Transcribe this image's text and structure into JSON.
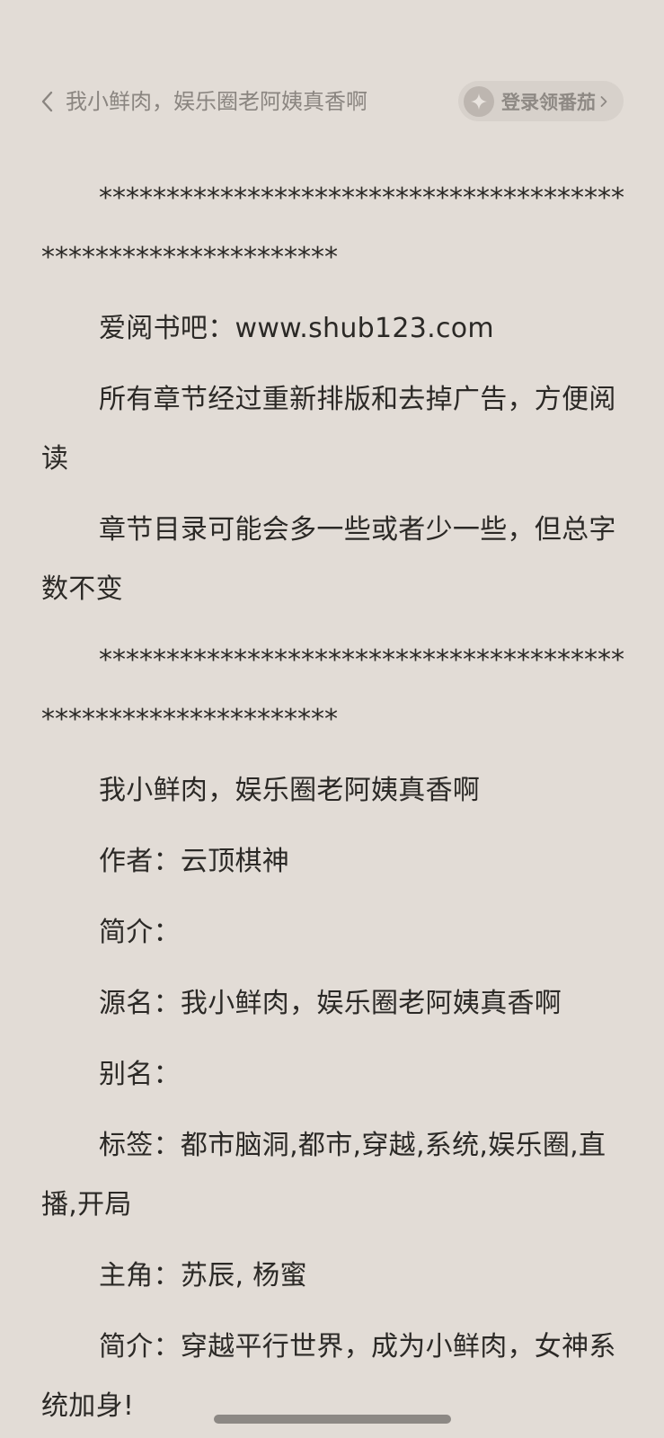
{
  "header": {
    "book_title": "我小鲜肉，娱乐圈老阿姨真香啊",
    "login_label": "登录领番茄",
    "back_icon": "chevron-left-icon",
    "login_icon": "sparkle-icon",
    "chevron_icon": "chevron-right-icon"
  },
  "content": {
    "paragraphs": [
      "*************************************************************",
      "爱阅书吧：www.shub123.com",
      "所有章节经过重新排版和去掉广告，方便阅读",
      "章节目录可能会多一些或者少一些，但总字数不变",
      "*************************************************************",
      "我小鲜肉，娱乐圈老阿姨真香啊",
      "作者：云顶棋神",
      "简介：",
      "源名：我小鲜肉，娱乐圈老阿姨真香啊",
      "别名：",
      "标签：都市脑洞,都市,穿越,系统,娱乐圈,直播,开局",
      "主角：苏辰, 杨蜜",
      "简介：穿越平行世界，成为小鲜肉，女神系统加身!"
    ]
  },
  "colors": {
    "background": "#e2dcd6",
    "text": "#2b2926",
    "muted": "#8a8580",
    "pill": "#d7d1cb"
  }
}
